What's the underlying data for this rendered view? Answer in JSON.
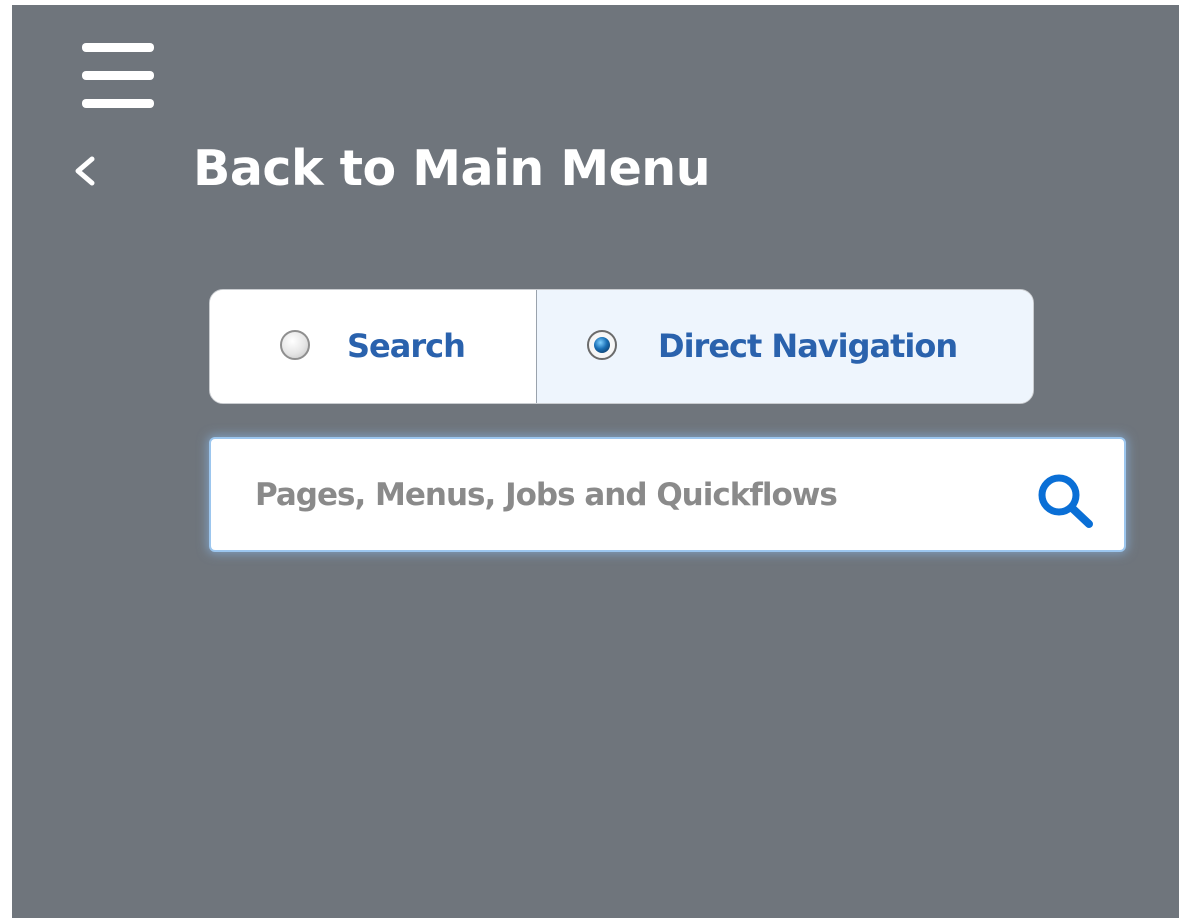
{
  "nav": {
    "back_label": "Back to Main Menu"
  },
  "mode": {
    "options": [
      {
        "label": "Search",
        "selected": false
      },
      {
        "label": "Direct Navigation",
        "selected": true
      }
    ]
  },
  "search": {
    "value": "",
    "placeholder": "Pages, Menus, Jobs and Quickflows"
  },
  "icons": {
    "menu": "hamburger-menu-icon",
    "back": "chevron-left-icon",
    "search": "search-icon"
  },
  "colors": {
    "panel_background": "#6f757c",
    "link_blue": "#2a62ad",
    "search_icon_blue": "#0a6fd6",
    "selected_option_background": "#eef5fd"
  }
}
